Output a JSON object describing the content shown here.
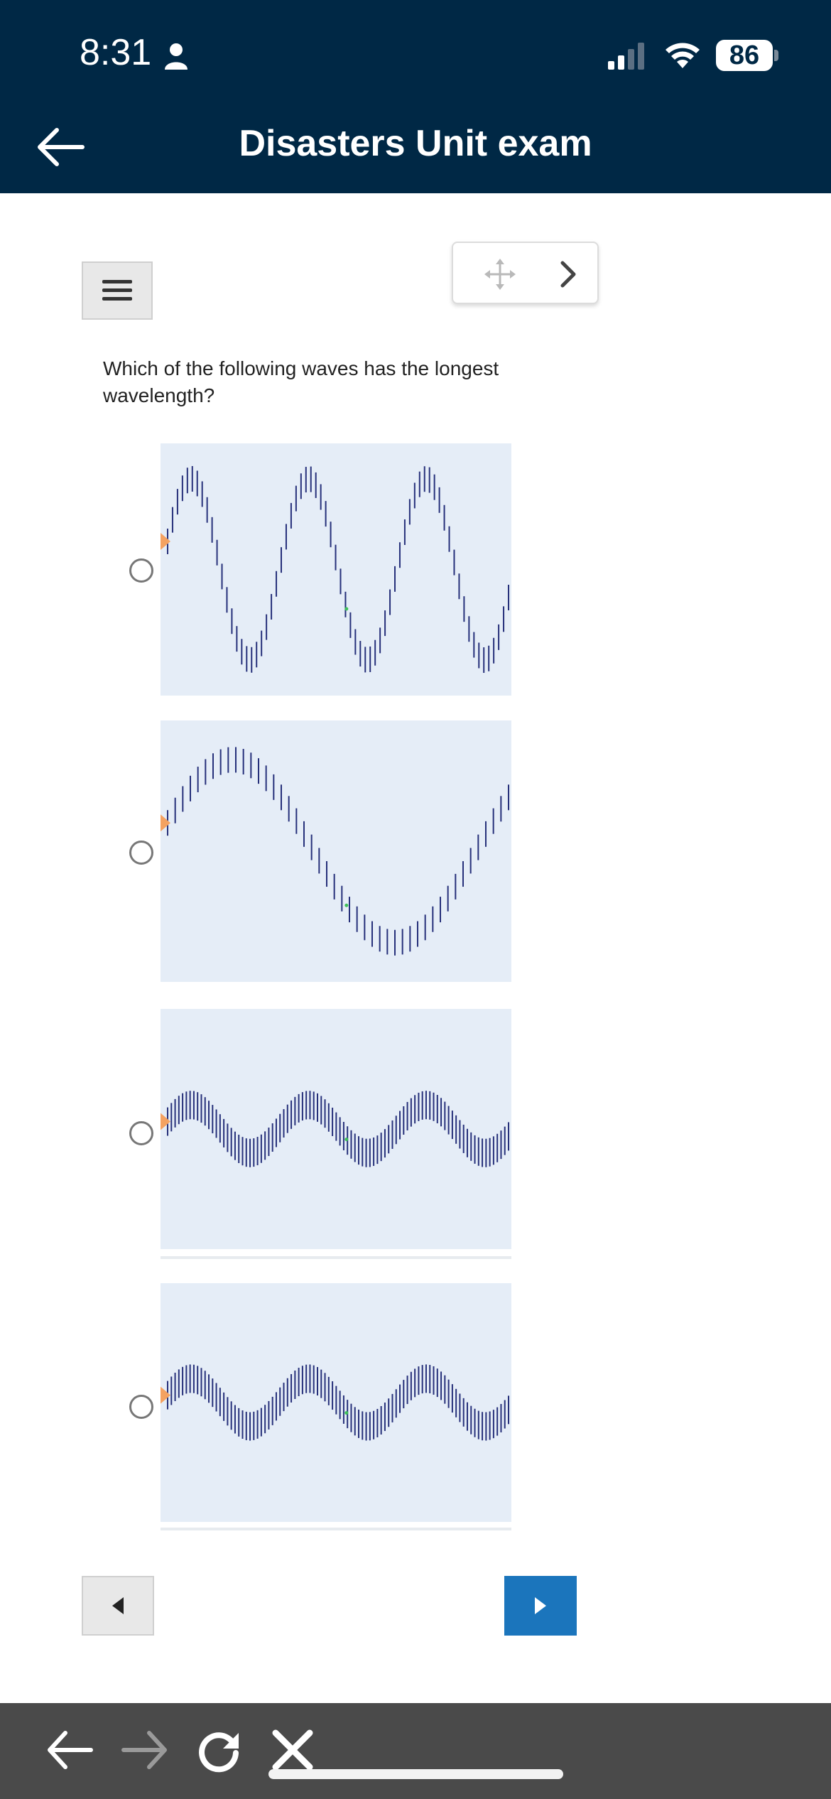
{
  "status_bar": {
    "time": "8:31",
    "battery": "86"
  },
  "header": {
    "title": "Disasters Unit exam"
  },
  "question": {
    "text": "Which of the following waves has the longest wavelength?"
  },
  "options": [
    {
      "cycles": 2.9,
      "amplitude_fraction": 0.72,
      "selected": false
    },
    {
      "cycles": 1.05,
      "amplitude_fraction": 0.7,
      "selected": false
    },
    {
      "cycles": 2.9,
      "amplitude_fraction": 0.2,
      "selected": false
    },
    {
      "cycles": 2.9,
      "amplitude_fraction": 0.2,
      "selected": false
    }
  ],
  "colors": {
    "header_bg": "#002845",
    "panel_bg": "#e5edf7",
    "wave_line": "#26307a",
    "source_marker": "#f4a261",
    "next_button": "#1b75bc",
    "bottom_bar": "#4a4a4a"
  }
}
